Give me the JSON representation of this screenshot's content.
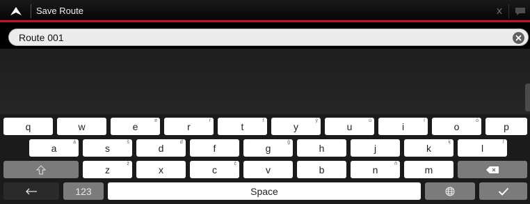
{
  "header": {
    "title": "Save Route",
    "back_icon": "up-arrow-icon",
    "right_icons": [
      "signal-icon",
      "chat-icon"
    ]
  },
  "input": {
    "value": "Route 001",
    "clear_icon": "clear-icon"
  },
  "keyboard": {
    "row1": [
      {
        "label": "q",
        "alt": ""
      },
      {
        "label": "w",
        "alt": ""
      },
      {
        "label": "e",
        "alt": "é"
      },
      {
        "label": "r",
        "alt": "ŕ"
      },
      {
        "label": "t",
        "alt": "ť"
      },
      {
        "label": "y",
        "alt": "ý"
      },
      {
        "label": "u",
        "alt": "ú"
      },
      {
        "label": "i",
        "alt": "í"
      },
      {
        "label": "o",
        "alt": "ó"
      },
      {
        "label": "p",
        "alt": ""
      }
    ],
    "row2": [
      {
        "label": "a",
        "alt": "á"
      },
      {
        "label": "s",
        "alt": "š"
      },
      {
        "label": "d",
        "alt": "ď"
      },
      {
        "label": "f",
        "alt": ""
      },
      {
        "label": "g",
        "alt": "ğ"
      },
      {
        "label": "h",
        "alt": ""
      },
      {
        "label": "j",
        "alt": ""
      },
      {
        "label": "k",
        "alt": "ķ"
      },
      {
        "label": "l",
        "alt": "ľ"
      }
    ],
    "row3": [
      {
        "label": "z",
        "alt": "ž"
      },
      {
        "label": "x",
        "alt": ""
      },
      {
        "label": "c",
        "alt": "č"
      },
      {
        "label": "v",
        "alt": ""
      },
      {
        "label": "b",
        "alt": ""
      },
      {
        "label": "n",
        "alt": "ň"
      },
      {
        "label": "m",
        "alt": ""
      }
    ],
    "shift_icon": "shift-icon",
    "backspace_icon": "backspace-icon",
    "back_icon": "back-arrow-icon",
    "numbers_label": "123",
    "space_label": "Space",
    "language_icon": "globe-icon",
    "done_icon": "checkmark-icon"
  },
  "colors": {
    "accent": "#c8102e",
    "key": "#ffffff",
    "key_dark": "#7b7b7b",
    "background": "#1b1b1b"
  }
}
